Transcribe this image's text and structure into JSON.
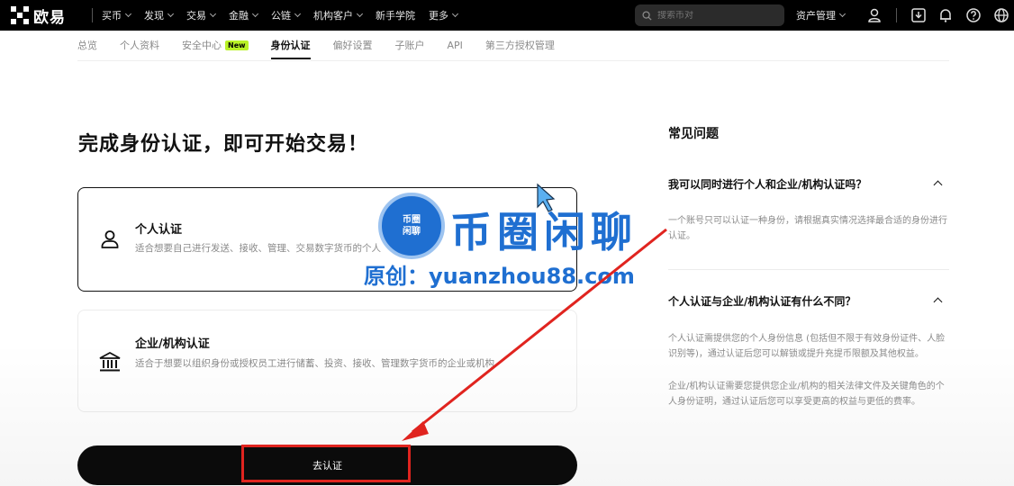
{
  "brand": {
    "name": "欧易"
  },
  "topnav": {
    "items": [
      {
        "label": "买币"
      },
      {
        "label": "发现"
      },
      {
        "label": "交易"
      },
      {
        "label": "金融"
      },
      {
        "label": "公链"
      },
      {
        "label": "机构客户"
      },
      {
        "label": "新手学院"
      },
      {
        "label": "更多"
      }
    ],
    "search_placeholder": "搜索币对",
    "asset_label": "资产管理"
  },
  "tabs": [
    {
      "label": "总览"
    },
    {
      "label": "个人资料"
    },
    {
      "label": "安全中心",
      "badge": "New"
    },
    {
      "label": "身份认证",
      "active": true
    },
    {
      "label": "偏好设置"
    },
    {
      "label": "子账户"
    },
    {
      "label": "API"
    },
    {
      "label": "第三方授权管理"
    }
  ],
  "main": {
    "headline": "完成身份认证，即可开始交易！",
    "options": [
      {
        "title": "个人认证",
        "desc": "适合想要自己进行发送、接收、管理、交易数字货币的个人"
      },
      {
        "title": "企业/机构认证",
        "desc": "适合于想要以组织身份或授权员工进行储蓄、投资、接收、管理数字货币的企业或机构"
      }
    ],
    "cta_label": "去认证"
  },
  "faq": {
    "title": "常见问题",
    "items": [
      {
        "q": "我可以同时进行个人和企业/机构认证吗？",
        "a": "一个账号只可以认证一种身份，请根据真实情况选择最合适的身份进行认证。"
      },
      {
        "q": "个人认证与企业/机构认证有什么不同？",
        "a": "个人认证需提供您的个人身份信息 (包括但不限于有效身份证件、人脸识别等)，通过认证后您可以解锁或提升充提币限额及其他权益。",
        "a2": "企业/机构认证需要您提供您企业/机构的相关法律文件及关键角色的个人身份证明，通过认证后您可以享受更高的权益与更低的费率。"
      }
    ]
  },
  "watermark": {
    "seal_line1": "币圈",
    "seal_line2": "闲聊",
    "title": "币圈闲聊",
    "subtitle": "原创：yuanzhou88.com"
  },
  "colors": {
    "accent_new": "#b9f227",
    "annotation_red": "#e0241f",
    "watermark_blue": "#1f6fd1"
  }
}
